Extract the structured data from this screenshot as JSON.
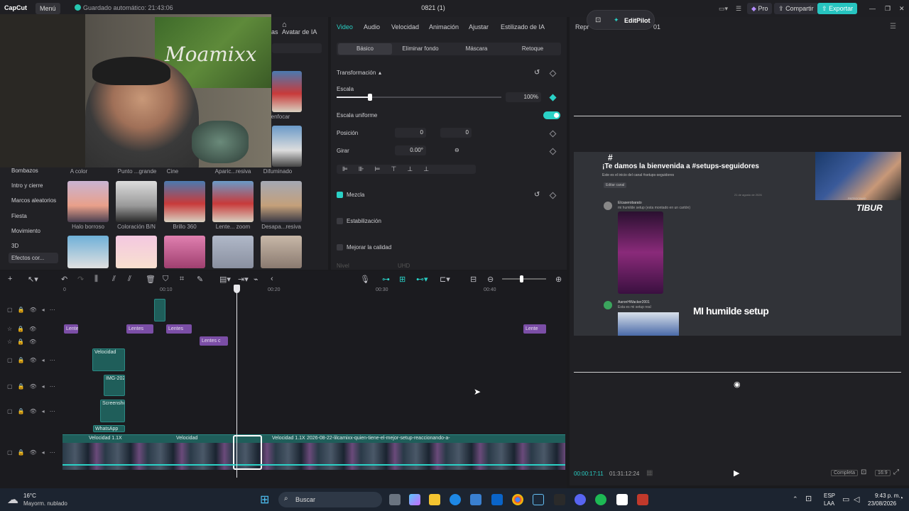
{
  "titlebar": {
    "app_name": "CapCut",
    "menu_label": "Menú",
    "autosave": "Guardado automático: 21:43:06",
    "project_title": "0821 (1)",
    "pro_label": "Pro",
    "share_label": "Compartir",
    "export_label": "Exportar"
  },
  "left_panel": {
    "avatar_tab": "Avatar de IA",
    "effects_tabs_partial": "ias",
    "categories": [
      "Bombazos",
      "Intro y cierre",
      "Marcos aleatorios",
      "Fiesta",
      "Movimiento",
      "3D",
      "Efectos cor..."
    ],
    "top_row_labels": [
      "A color",
      "Punto ...grande",
      "Cine",
      "Aparic...resiva",
      "Difuminado"
    ],
    "row2_labels": [
      "Halo borroso",
      "Coloración B/N",
      "Brillo 360",
      "Lente... zoom",
      "Desapa...resiva"
    ],
    "partial_label_top": "enfocar"
  },
  "webcam": {
    "sign_text": "Moamixx"
  },
  "properties": {
    "tabs": [
      "Video",
      "Audio",
      "Velocidad",
      "Animación",
      "Ajustar",
      "Estilizado de IA"
    ],
    "sub_tabs": [
      "Básico",
      "Eliminar fondo",
      "Máscara",
      "Retoque"
    ],
    "transform_label": "Transformación",
    "scale_label": "Escala",
    "scale_value": "100%",
    "uniform_scale_label": "Escala uniforme",
    "uniform_scale_on": true,
    "position_label": "Posición",
    "pos_x_label": "X",
    "pos_x_value": "0",
    "pos_y_label": "Y",
    "pos_y_value": "0",
    "rotate_label": "Girar",
    "rotate_value": "0.00°",
    "blend_label": "Mezcla",
    "stabilize_label": "Estabilización",
    "quality_label": "Mejorar la calidad",
    "level_label": "Nivel",
    "level_value": "UHD"
  },
  "player": {
    "title_partial": "Repr",
    "title_suffix": "01",
    "editpilot_label": "EditPilot",
    "preview": {
      "welcome_text": "¡Te damos la bienvenida a #setups-seguidores",
      "sub_text": "Este es el inicio del canal #setups-seguidores",
      "edit_channel": "Editar canal",
      "date_divider": "21 de agosto de 2026",
      "user1": "Elcaserobarato",
      "user1_msg": "mi humilde setup (esta montado en un cartón)",
      "user2": "AaronHWacker2001",
      "user2_msg": "Esta es mi setup real",
      "overlay_title": "MI humilde setup",
      "brand_partial": "TIBUR",
      "sponsor_partial": "PATROCINAD"
    },
    "current_time": "00:00:17:11",
    "total_time": "01:31:12:24",
    "fit_label": "Completa",
    "ratio_label": "16:9"
  },
  "timeline": {
    "ruler": [
      "0",
      "00:10",
      "00:20",
      "00:30",
      "00:40"
    ],
    "fx_clips": [
      "Lentes",
      "Lentes",
      "Lentes",
      "Lentes c",
      "Lente"
    ],
    "overlay_clips": [
      "Velocidad",
      "IMG-202",
      "Screensho",
      "WhatsApp"
    ],
    "main_track_label": "2026-08-22-lilcamixx-quien-tiene-el-mejor-setup-reaccionando-a-",
    "main_track_speed": "Velocidad 1.1X",
    "speed_short": "Velocidad"
  },
  "taskbar": {
    "weather_temp": "16°C",
    "weather_desc": "Mayorm. nublado",
    "search_label": "Buscar",
    "lang_top": "ESP",
    "lang_bottom": "LAA",
    "time": "9:43 p. m.",
    "date": "23/08/2026"
  },
  "colors": {
    "accent": "#2ad1c6",
    "export_bg": "#27c4c0",
    "fx_clip": "#7b4ea6",
    "video_clip": "#1f5e5a"
  }
}
